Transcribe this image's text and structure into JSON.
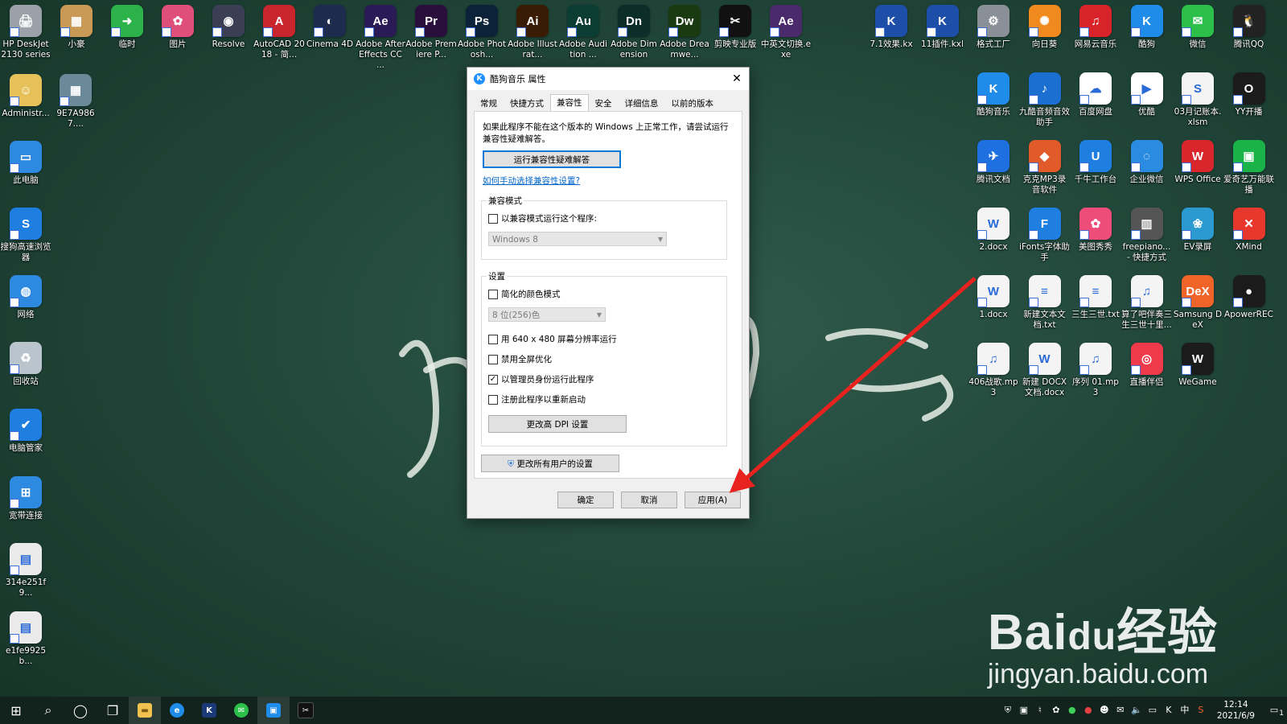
{
  "desktop": {
    "top_row": [
      {
        "label": "HP DeskJet 2130 series",
        "icon": "printer-icon",
        "color": "#9aa1a8",
        "glyph": "🖨"
      },
      {
        "label": "小豪",
        "icon": "photo-icon",
        "color": "#c89a55",
        "glyph": "▦"
      },
      {
        "label": "临时",
        "icon": "arrow-folder-icon",
        "color": "#2bb34a",
        "glyph": "➜"
      },
      {
        "label": "图片",
        "icon": "butterfly-icon",
        "color": "#e04f7a",
        "glyph": "✿"
      },
      {
        "label": "Resolve",
        "icon": "resolve-icon",
        "color": "#3a3f55",
        "glyph": "◉"
      },
      {
        "label": "AutoCAD 2018 - 简...",
        "icon": "autocad-icon",
        "color": "#c8262c",
        "glyph": "A"
      },
      {
        "label": "Cinema 4D",
        "icon": "cinema4d-icon",
        "color": "#1d2b4c",
        "glyph": "◐"
      },
      {
        "label": "Adobe After Effects CC ...",
        "icon": "after-effects-icon",
        "color": "#2a1a56",
        "glyph": "Ae"
      },
      {
        "label": "Adobe Premiere P...",
        "icon": "premiere-icon",
        "color": "#2a0f3d",
        "glyph": "Pr"
      },
      {
        "label": "Adobe Photosh...",
        "icon": "photoshop-icon",
        "color": "#0b2238",
        "glyph": "Ps"
      },
      {
        "label": "Adobe Illustrat...",
        "icon": "illustrator-icon",
        "color": "#3a1c04",
        "glyph": "Ai"
      },
      {
        "label": "Adobe Audition ...",
        "icon": "audition-icon",
        "color": "#0b3d34",
        "glyph": "Au"
      },
      {
        "label": "Adobe Dimension",
        "icon": "dimension-icon",
        "color": "#0b2e2a",
        "glyph": "Dn"
      },
      {
        "label": "Adobe Dreamwe...",
        "icon": "dreamweaver-icon",
        "color": "#1a3a12",
        "glyph": "Dw"
      },
      {
        "label": "剪映专业版",
        "icon": "capcut-icon",
        "color": "#111111",
        "glyph": "✂"
      },
      {
        "label": "中英文切换.exe",
        "icon": "ae-switch-icon",
        "color": "#4a2a6a",
        "glyph": "Ae"
      }
    ],
    "top_right_row": [
      {
        "label": "7.1效果.kx",
        "icon": "kx-file-icon",
        "color": "#1d4ea8",
        "glyph": "K"
      },
      {
        "label": "11插件.kxl",
        "icon": "kxl-file-icon",
        "color": "#1d4ea8",
        "glyph": "K"
      },
      {
        "label": "格式工厂",
        "icon": "format-factory-icon",
        "color": "#8a9097",
        "glyph": "⚙"
      },
      {
        "label": "向日葵",
        "icon": "sunflower-icon",
        "color": "#f08a1e",
        "glyph": "✺"
      },
      {
        "label": "网易云音乐",
        "icon": "netease-music-icon",
        "color": "#d8232a",
        "glyph": "♫"
      },
      {
        "label": "酷狗",
        "icon": "kugou-icon",
        "color": "#1e8ce8",
        "glyph": "K"
      },
      {
        "label": "微信",
        "icon": "wechat-icon",
        "color": "#2cc04a",
        "glyph": "✉"
      },
      {
        "label": "腾讯QQ",
        "icon": "qq-icon",
        "color": "#222222",
        "glyph": "🐧"
      }
    ],
    "right_grid": [
      {
        "label": "酷狗音乐",
        "icon": "kugou-music-icon",
        "color": "#1e8ce8",
        "glyph": "K"
      },
      {
        "label": "九酷音频音效助手",
        "icon": "audio-helper-icon",
        "color": "#1a6fd0",
        "glyph": "♪"
      },
      {
        "label": "百度网盘",
        "icon": "baidu-netdisk-icon",
        "color": "#ffffff",
        "glyph": "☁"
      },
      {
        "label": "优酷",
        "icon": "youku-icon",
        "color": "#ffffff",
        "glyph": "▶"
      },
      {
        "label": "03月记账本.xlsm",
        "icon": "excel-file-icon",
        "color": "#f4f4f4",
        "glyph": "S"
      },
      {
        "label": "YY开播",
        "icon": "yy-icon",
        "color": "#1b1b1b",
        "glyph": "O"
      },
      {
        "label": "腾讯文档",
        "icon": "tencent-docs-icon",
        "color": "#1e6fe0",
        "glyph": "✈"
      },
      {
        "label": "克克MP3录音软件",
        "icon": "mp3-recorder-icon",
        "color": "#e05a2a",
        "glyph": "◆"
      },
      {
        "label": "千牛工作台",
        "icon": "qianniu-icon",
        "color": "#1e7fe0",
        "glyph": "U"
      },
      {
        "label": "企业微信",
        "icon": "wecom-icon",
        "color": "#2a8ce0",
        "glyph": "◌"
      },
      {
        "label": "WPS Office",
        "icon": "wps-icon",
        "color": "#d8262c",
        "glyph": "W"
      },
      {
        "label": "爱奇艺万能联播",
        "icon": "iqiyi-icon",
        "color": "#19b34a",
        "glyph": "▣"
      },
      {
        "label": "2.docx",
        "icon": "word-file-icon",
        "color": "#f4f4f4",
        "glyph": "W"
      },
      {
        "label": "iFonts字体助手",
        "icon": "ifonts-icon",
        "color": "#1e7fe0",
        "glyph": "F"
      },
      {
        "label": "美图秀秀",
        "icon": "meitu-icon",
        "color": "#ee4d7a",
        "glyph": "✿"
      },
      {
        "label": "freepiano... - 快捷方式",
        "icon": "freepiano-icon",
        "color": "#555555",
        "glyph": "▥"
      },
      {
        "label": "EV录屏",
        "icon": "ev-recorder-icon",
        "color": "#2a9ad0",
        "glyph": "❀"
      },
      {
        "label": "XMind",
        "icon": "xmind-icon",
        "color": "#e8372c",
        "glyph": "✕"
      },
      {
        "label": "1.docx",
        "icon": "word-file-icon",
        "color": "#f4f4f4",
        "glyph": "W"
      },
      {
        "label": "新建文本文档.txt",
        "icon": "text-file-icon",
        "color": "#f4f4f4",
        "glyph": "≡"
      },
      {
        "label": "三生三世.txt",
        "icon": "text-file-icon",
        "color": "#f4f4f4",
        "glyph": "≡"
      },
      {
        "label": "算了吧伴奏三生三世十里...",
        "icon": "mp3-file-icon",
        "color": "#f4f4f4",
        "glyph": "♫"
      },
      {
        "label": "Samsung DeX",
        "icon": "samsung-dex-icon",
        "color": "#f0642a",
        "glyph": "DeX"
      },
      {
        "label": "ApowerREC",
        "icon": "apowerrec-icon",
        "color": "#1b1b1b",
        "glyph": "●"
      },
      {
        "label": "406战歌.mp3",
        "icon": "mp3-file-icon",
        "color": "#f4f4f4",
        "glyph": "♫"
      },
      {
        "label": "新建 DOCX 文档.docx",
        "icon": "word-file-icon",
        "color": "#f4f4f4",
        "glyph": "W"
      },
      {
        "label": "序列 01.mp3",
        "icon": "mp3-file-icon",
        "color": "#f4f4f4",
        "glyph": "♫"
      },
      {
        "label": "直播伴侣",
        "icon": "live-companion-icon",
        "color": "#ee3a4a",
        "glyph": "◎"
      },
      {
        "label": "WeGame",
        "icon": "wegame-icon",
        "color": "#1b1b1b",
        "glyph": "W"
      }
    ],
    "left_column": [
      {
        "label": "Administr...",
        "icon": "user-folder-icon",
        "color": "#e6c15a",
        "glyph": "☺"
      },
      {
        "label": "9E7A9867....",
        "icon": "photo-file-icon",
        "color": "#6a8a9a",
        "glyph": "▦"
      },
      {
        "label": "此电脑",
        "icon": "this-pc-icon",
        "color": "#2d8ae0",
        "glyph": "▭"
      },
      {
        "label": "搜狗高速浏览器",
        "icon": "sogou-browser-icon",
        "color": "#1e7fe0",
        "glyph": "S"
      },
      {
        "label": "网络",
        "icon": "network-icon",
        "color": "#2d8ae0",
        "glyph": "◍"
      },
      {
        "label": "回收站",
        "icon": "recycle-bin-icon",
        "color": "#b9c4cc",
        "glyph": "♻"
      },
      {
        "label": "电脑管家",
        "icon": "pc-manager-icon",
        "color": "#1e7fe0",
        "glyph": "✔"
      },
      {
        "label": "宽带连接",
        "icon": "broadband-icon",
        "color": "#2d8ae0",
        "glyph": "⊞"
      },
      {
        "label": "314e251f9...",
        "icon": "image-file-icon",
        "color": "#eaeaea",
        "glyph": "▤"
      },
      {
        "label": "e1fe9925b...",
        "icon": "image-file-icon",
        "color": "#eaeaea",
        "glyph": "▤"
      }
    ]
  },
  "dialog": {
    "title": "酷狗音乐 属性",
    "tabs": [
      "常规",
      "快捷方式",
      "兼容性",
      "安全",
      "详细信息",
      "以前的版本"
    ],
    "active_tab": 2,
    "intro": "如果此程序不能在这个版本的 Windows 上正常工作，请尝试运行兼容性疑难解答。",
    "troubleshoot_button": "运行兼容性疑难解答",
    "manual_link": "如何手动选择兼容性设置?",
    "compat_group": {
      "title": "兼容模式",
      "checkbox": "以兼容模式运行这个程序:",
      "checked": false,
      "os_value": "Windows 8"
    },
    "settings_group": {
      "title": "设置",
      "reduced_color": "简化的颜色模式",
      "reduced_color_checked": false,
      "color_value": "8 位(256)色",
      "res_640": "用 640 x 480 屏幕分辨率运行",
      "res_640_checked": false,
      "disable_fullscreen": "禁用全屏优化",
      "disable_fullscreen_checked": false,
      "run_as_admin": "以管理员身份运行此程序",
      "run_as_admin_checked": true,
      "register_restart": "注册此程序以重新启动",
      "register_restart_checked": false,
      "dpi_button": "更改高 DPI 设置"
    },
    "all_users_button": "更改所有用户的设置",
    "ok": "确定",
    "cancel": "取消",
    "apply": "应用(A)"
  },
  "annotation": {
    "arrow_color": "#e8221e"
  },
  "watermark": {
    "line1": "Bai",
    "line1_brand": "du",
    "line1_suffix": "经验",
    "line2": "jingyan.baidu.com"
  },
  "taskbar": {
    "time": "12:14",
    "date": "2021/6/9",
    "ime": "中",
    "notification_count": "1"
  }
}
